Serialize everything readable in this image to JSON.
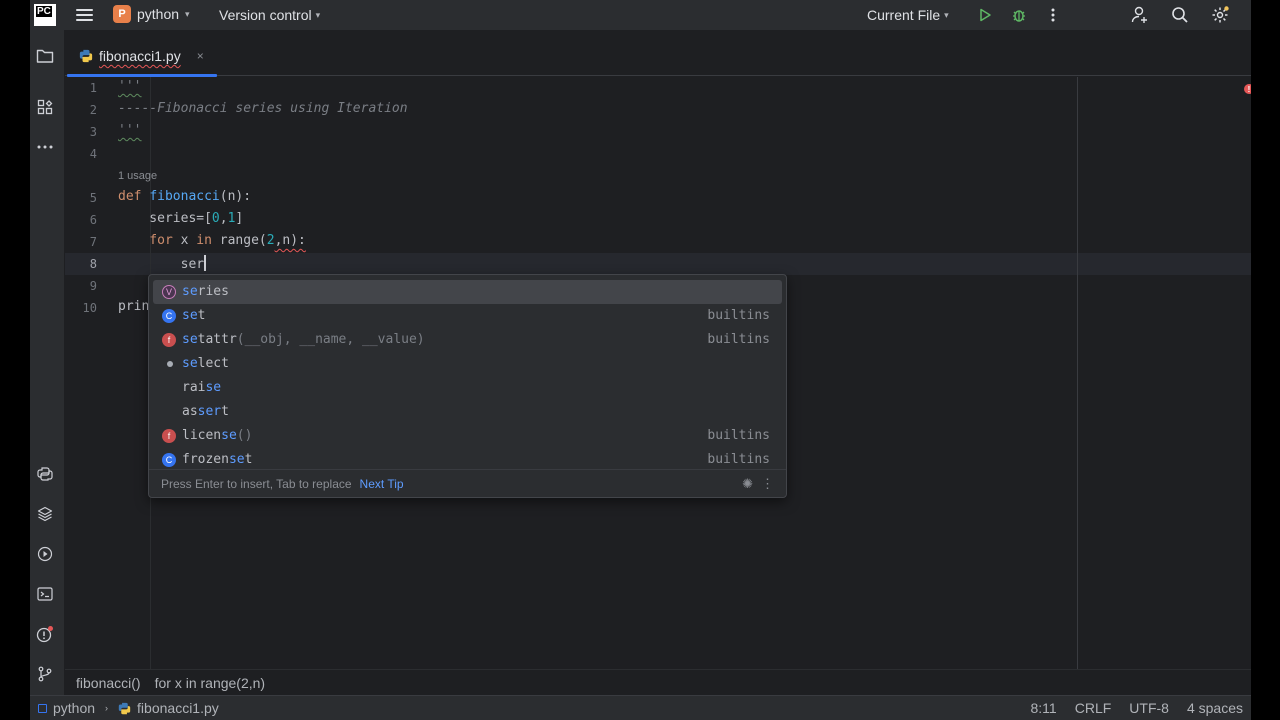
{
  "topbar": {
    "logo": "PC",
    "project_badge": "P",
    "project_name": "python",
    "version_control": "Version control",
    "run_config": "Current File"
  },
  "tab": {
    "file_name": "fibonacci1.py",
    "close": "×"
  },
  "editor": {
    "line_numbers": [
      "1",
      "2",
      "3",
      "4",
      "5",
      "6",
      "7",
      "8",
      "9",
      "10"
    ],
    "line1": "'''",
    "line2": "-----Fibonacci series using Iteration",
    "line3": "'''",
    "usage_hint": "1 usage",
    "line5_kw": "def",
    "line5_fn": "fibonacci",
    "line5_rest": "(n):",
    "line6_a": "    series=[",
    "line6_n1": "0",
    "line6_c": ",",
    "line6_n2": "1",
    "line6_b": "]",
    "line7_kw1": "    for",
    "line7_a": " x ",
    "line7_kw2": "in",
    "line7_b": " range(",
    "line7_n": "2",
    "line7_c": ",n):",
    "line8": "        ser",
    "line10": "prin"
  },
  "completion": {
    "items": [
      {
        "kind": "V",
        "match": "se",
        "rest": "ries",
        "params": "",
        "type": ""
      },
      {
        "kind": "C",
        "match": "se",
        "rest": "t",
        "params": "",
        "type": "builtins"
      },
      {
        "kind": "F",
        "match": "se",
        "rest": "tattr",
        "params": "(__obj, __name, __value)",
        "type": "builtins"
      },
      {
        "kind": "dot",
        "match": "se",
        "rest": "lect",
        "params": "",
        "type": ""
      },
      {
        "kind": "",
        "pre": "rai",
        "match": "se",
        "rest": "",
        "params": "",
        "type": ""
      },
      {
        "kind": "",
        "pre": "as",
        "match": "ser",
        "rest": "t",
        "params": "",
        "type": ""
      },
      {
        "kind": "F",
        "pre": "licen",
        "match": "se",
        "rest": "",
        "params": "()",
        "type": "builtins"
      },
      {
        "kind": "C",
        "pre": "frozen",
        "match": "se",
        "rest": "t",
        "params": "",
        "type": "builtins"
      }
    ],
    "footer_hint": "Press Enter to insert, Tab to replace",
    "footer_link": "Next Tip"
  },
  "breadcrumbs": [
    "fibonacci()",
    "for x in range(2,n)"
  ],
  "statusbar": {
    "project": "python",
    "file": "fibonacci1.py",
    "position": "8:11",
    "line_sep": "CRLF",
    "encoding": "UTF-8",
    "indent": "4 spaces"
  },
  "colors": {
    "accent": "#3574f0",
    "error": "#e55757",
    "bg": "#1e1f22",
    "panel": "#2b2d30"
  }
}
